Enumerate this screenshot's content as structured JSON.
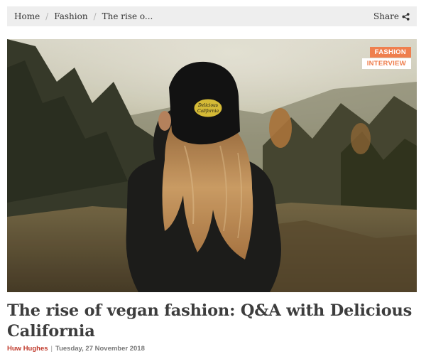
{
  "breadcrumb": {
    "items": [
      "Home",
      "Fashion",
      "The rise o..."
    ],
    "separator": "/"
  },
  "share": {
    "label": "Share",
    "icon": "share-icon"
  },
  "hero": {
    "tags": [
      "FASHION",
      "INTERVIEW"
    ],
    "cap_logo_line1": "Delicious",
    "cap_logo_line2": "California"
  },
  "article": {
    "title": "The rise of vegan fashion: Q&A with Delicious California",
    "author": "Huw Hughes",
    "separator": "|",
    "date": "Tuesday, 27 November 2018"
  },
  "colors": {
    "accent": "#ef7f4e",
    "author": "#c0392b",
    "breadcrumb_bg": "#eeeeee"
  }
}
